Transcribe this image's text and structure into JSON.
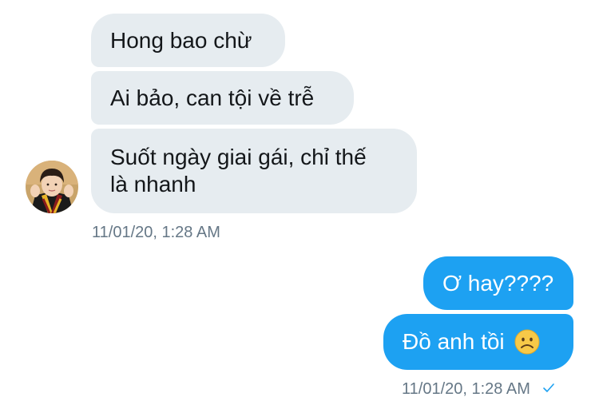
{
  "incoming": {
    "messages": [
      "Hong bao chừ",
      "Ai bảo, can tội về trễ",
      "Suốt ngày giai gái, chỉ thế là nhanh"
    ],
    "message_3_line_1": "Suốt ngày giai gái, chỉ thế",
    "message_3_line_2": "là nhanh",
    "timestamp": "11/01/20, 1:28 AM"
  },
  "outgoing": {
    "messages": [
      "Ơ hay????",
      "Đồ anh tồi"
    ],
    "emoji": "☹",
    "timestamp": "11/01/20, 1:28 AM",
    "status_icon": "checkmark-icon"
  },
  "colors": {
    "incoming_bubble": "#e6ecf0",
    "outgoing_bubble": "#1da1f2",
    "timestamp_text": "#657786",
    "emoji_face": "#f7c948"
  }
}
